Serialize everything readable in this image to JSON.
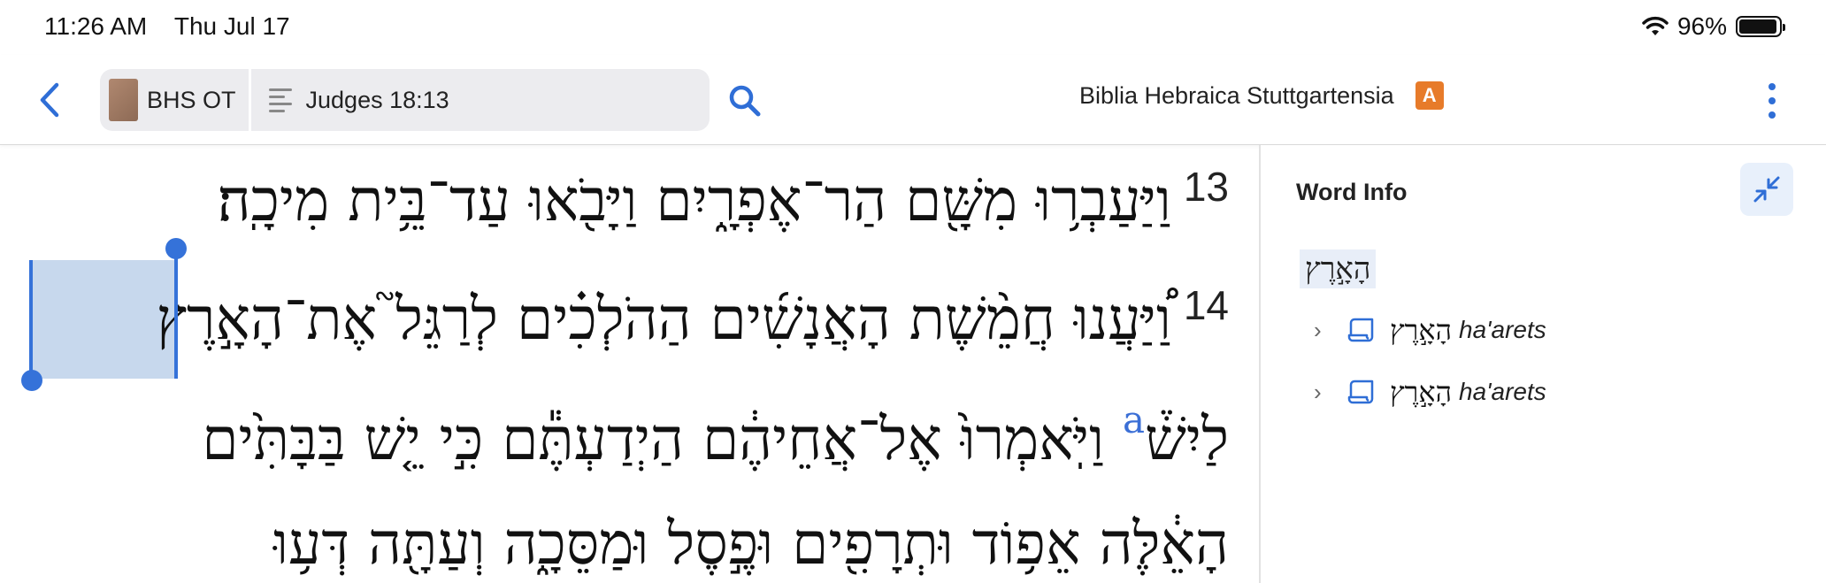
{
  "status_bar": {
    "time": "11:26 AM",
    "date": "Thu Jul 17",
    "battery": "96%",
    "battery_level": 0.96
  },
  "toolbar": {
    "back_icon": "chevron-left-icon",
    "resource_label": "BHS OT",
    "reference_label": "Judges 18:13",
    "search_icon": "search-icon",
    "title": "Biblia Hebraica Stuttgartensia",
    "badge": "A",
    "more_icon": "more-vertical-icon",
    "accent_color": "#2f6ed6",
    "badge_color": "#e77b2a"
  },
  "text": {
    "verse_13_number": "13",
    "line_1": "וַיַּעַבְר֥וּ מִשָּׁ֖ם הַר־אֶפְרָ֑יִם וַיָּבֹ֖אוּ עַד־בֵּ֥ית מִיכָֽה׃",
    "verse_14_number": "14",
    "line_2": "וַ֠יַּעֲנוּ חֲמֵ֨שֶׁת הָאֲנָשִׁ֜ים הַהֹלְכִ֗ים לְרַגֵּל֮ אֶת־הָאָ֣רֶץ",
    "line_3a": "לַיִשׁ֒",
    "footnote": "a",
    "line_3b": "וַיֹּֽאמְרוּ֙ אֶל־אֲחֵיהֶ֔ם הַיְדַעְתֶּ֕ם כִּ֣י יֵ֤שׁ בַּבָּתִּ֙ים",
    "line_4": "הָאֵ֔לֶּה אֵפ֥וֹד וּתְרָפִ֖ים וּפֶ֣סֶל וּמַסֵּכָ֑ה וְעַתָּ֖ה דְּע֥וּ"
  },
  "word_info": {
    "title": "Word Info",
    "collapse_icon": "collapse-arrows-icon",
    "headword": "הָאָ֣רֶץ",
    "entries": [
      {
        "hebrew": "הָאָ֣רֶץ",
        "translit": "ha'arets"
      },
      {
        "hebrew": "הָאָ֣רֶץ",
        "translit": "ha'arets"
      }
    ]
  }
}
